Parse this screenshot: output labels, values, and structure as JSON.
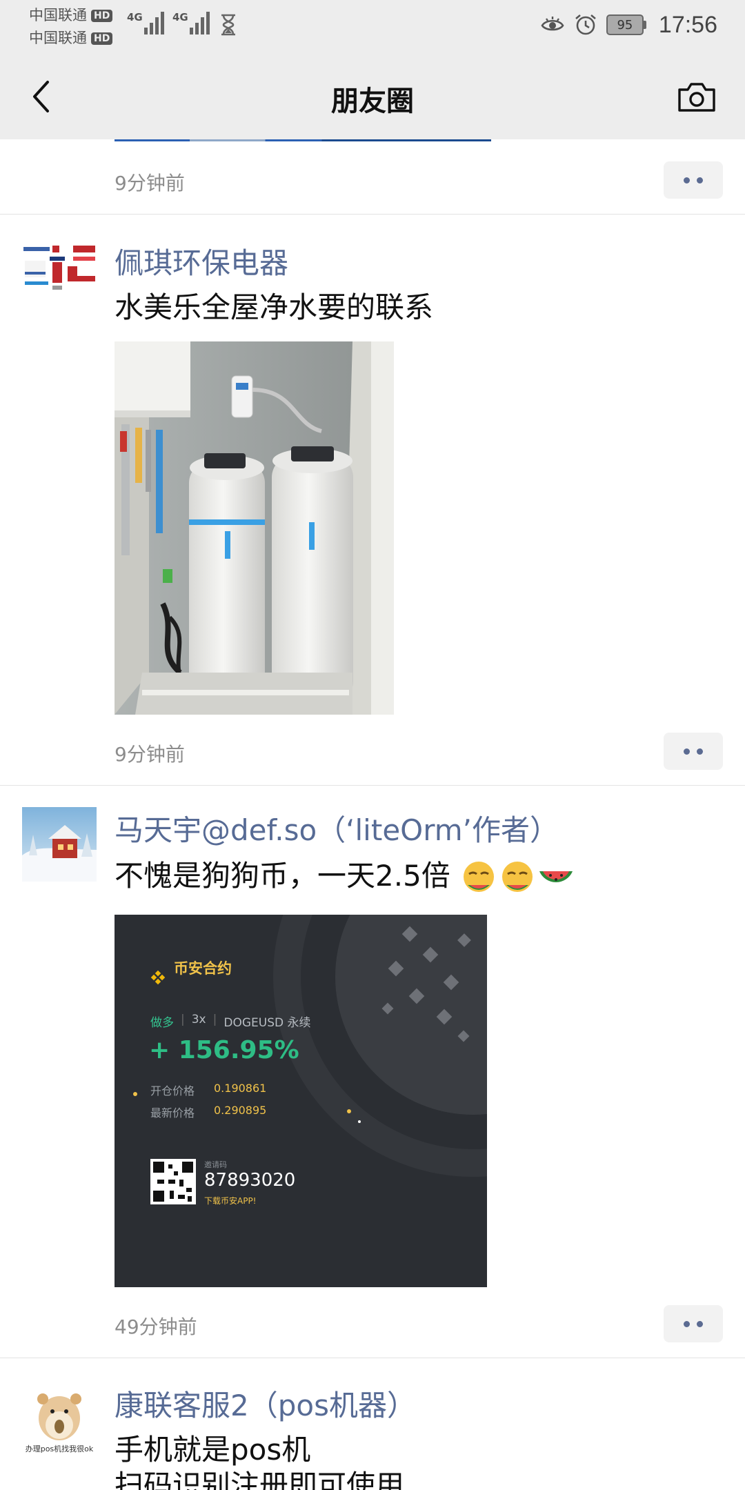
{
  "status_bar": {
    "carrier1": "中国联通",
    "carrier2": "中国联通",
    "hd": "HD",
    "net1": "4G",
    "net2": "4G",
    "battery": "95",
    "time": "17:56"
  },
  "nav": {
    "title": "朋友圈"
  },
  "feed": {
    "top_time": "9分钟前",
    "posts": [
      {
        "author": "佩琪环保电器",
        "text": "水美乐全屋净水要的联系",
        "time": "9分钟前"
      },
      {
        "author": "马天宇@def.so（‘liteOrm’作者）",
        "text": "不愧是狗狗币，一天2.5倍",
        "time": "49分钟前",
        "image": {
          "brand": "币安合约",
          "position": "做多",
          "leverage": "3x",
          "pair": "DOGEUSD 永续",
          "pnl": "+ 156.95%",
          "open_label": "开仓价格",
          "open_value": "0.190861",
          "latest_label": "最新价格",
          "latest_value": "0.290895",
          "code_label": "邀请码",
          "code": "87893020",
          "download": "下载币安APP!"
        }
      },
      {
        "author": "康联客服2（pos机器）",
        "text": "手机就是pos机",
        "text2": "扫码识别注册即可使用",
        "avatar_caption": "办理pos机找我很ok"
      }
    ]
  },
  "colors": {
    "link": "#576b95",
    "bar_bg": "#ededed",
    "time_text": "#8c8c8c"
  }
}
